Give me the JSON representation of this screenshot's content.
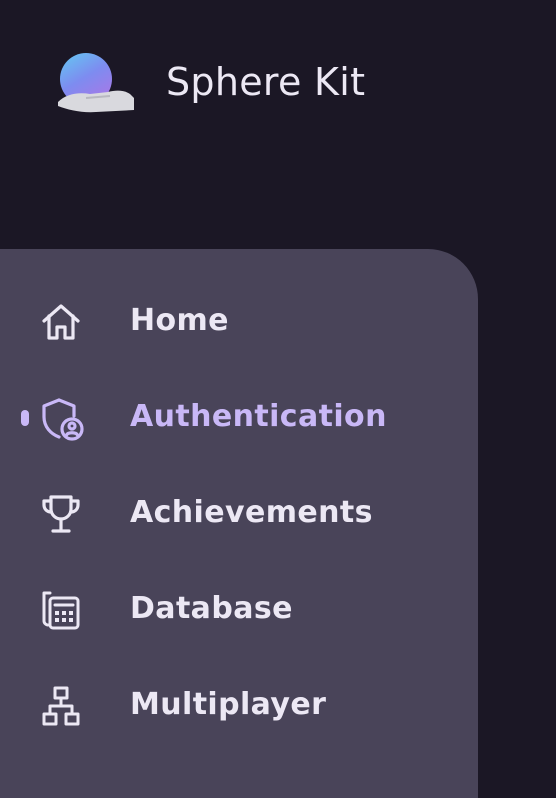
{
  "brand": {
    "title": "Sphere Kit",
    "logo_icon": "sphere-hand-logo"
  },
  "colors": {
    "background": "#1b1725",
    "panel": "#494459",
    "text": "#ece8f4",
    "accent": "#c9b8f7"
  },
  "nav": {
    "items": [
      {
        "label": "Home",
        "icon": "home-icon",
        "active": false
      },
      {
        "label": "Authentication",
        "icon": "shield-user-icon",
        "active": true
      },
      {
        "label": "Achievements",
        "icon": "trophy-icon",
        "active": false
      },
      {
        "label": "Database",
        "icon": "calculator-icon",
        "active": false
      },
      {
        "label": "Multiplayer",
        "icon": "network-hierarchy-icon",
        "active": false
      }
    ]
  }
}
